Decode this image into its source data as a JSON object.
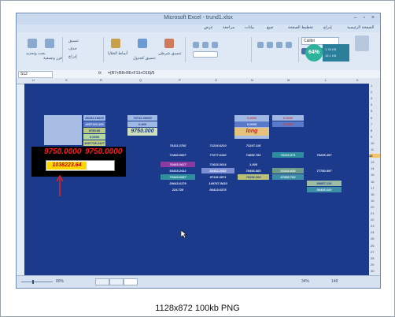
{
  "window": {
    "title": "Microsoft Excel - trund1.xlsx",
    "controls": "– ▫ ×"
  },
  "ribbon_tabs": [
    "الصفحة الرئيسية",
    "إدراج",
    "تخطيط الصفحة",
    "صيغ",
    "بيانات",
    "مراجعة",
    "عرض"
  ],
  "ribbon": {
    "font_name": "Calibri",
    "groups": [
      {
        "label": "إدراج"
      },
      {
        "label": "حذف"
      },
      {
        "label": "تنسيق"
      },
      {
        "label": "فرز وتصفية"
      },
      {
        "label": "بحث وتحديد"
      },
      {
        "label": "أنماط الخلايا"
      },
      {
        "label": "تنسيق شرطي"
      },
      {
        "label": "تنسيق كجدول"
      }
    ]
  },
  "overlay": {
    "percent": "64%",
    "up_rate": "1.76 KB",
    "down_rate": "15.1 KB"
  },
  "formula_bar": {
    "name_box": "S12",
    "fx": "fx",
    "formula": "=(R7+R8+R6+F13+O16)/5"
  },
  "column_headers": [
    "U",
    "S",
    "R",
    "Q",
    "P",
    "O",
    "N",
    "M",
    "L",
    "K"
  ],
  "row_headers": [
    "1",
    "2",
    "3",
    "4",
    "5",
    "6",
    "7",
    "8",
    "9",
    "10",
    "11",
    "12",
    "13",
    "14",
    "15",
    "16",
    "17",
    "18",
    "19",
    "20",
    "21",
    "22",
    "23",
    "24",
    "25",
    "26",
    "27",
    "28",
    "29",
    "30"
  ],
  "selected_row": "12",
  "cells": [
    {
      "id": "r6c1",
      "text": "86433.16629",
      "bg": "#9fb8e3",
      "fg": "#1e3c8c"
    },
    {
      "id": "r6c2",
      "text": "74712.30000",
      "bg": "#9fb8e3",
      "fg": "#1e3c8c"
    },
    {
      "id": "r6c3",
      "text": "0.0000",
      "bg": "#9fb8e3",
      "fg": "#d04040"
    },
    {
      "id": "r6c4",
      "text": "0.0000",
      "bg": "#9fb8e3",
      "fg": "#d04040"
    },
    {
      "id": "r7c1",
      "text": "4857194.365",
      "bg": "#5a79c9",
      "fg": "#d8e4ff"
    },
    {
      "id": "r7c2",
      "text": "0.900",
      "bg": "#9fb8e3",
      "fg": "#1e3c8c"
    },
    {
      "id": "r7c3",
      "text": "0.0000",
      "bg": "#5a79c9",
      "fg": "#e8eefc"
    },
    {
      "id": "r7c4",
      "text": "0.7586",
      "bg": "#5a79c9",
      "fg": "#d04040"
    },
    {
      "id": "r8c1",
      "text": "9750.00",
      "bg": "#b7c87e",
      "fg": "#1e3c8c"
    },
    {
      "id": "r8c2",
      "text": "9750.000",
      "bg": "#cfe0bc",
      "fg": "#1e3c8c"
    },
    {
      "id": "r8c3",
      "text": "long",
      "bg": "#e6c37c",
      "fg": "#c02020"
    },
    {
      "id": "r9c1",
      "text": "0.0000",
      "bg": "#b4d7a0",
      "fg": "#1e3c8c"
    },
    {
      "id": "r10c1",
      "text": "4057738.2427",
      "bg": "#c2d086",
      "fg": "#1e3c8c"
    },
    {
      "id": "r10c2",
      "text": "74113.3792",
      "bg": "#1b3a8c",
      "fg": "#e8eefc"
    },
    {
      "id": "r10c3",
      "text": "71216.6210",
      "bg": "#1b3a8c",
      "fg": "#e8eefc"
    },
    {
      "id": "r10c4",
      "text": "71247.118",
      "bg": "#1b3a8c",
      "fg": "#e8eefc"
    },
    {
      "id": "r11c1",
      "text": "72466.6607",
      "bg": "#1b3a8c",
      "fg": "#e8eefc"
    },
    {
      "id": "r11c2",
      "text": "77277.6152",
      "bg": "#1b3a8c",
      "fg": "#e8eefc"
    },
    {
      "id": "r11c3",
      "text": "74853.782",
      "bg": "#1b3a8c",
      "fg": "#e8eefc"
    },
    {
      "id": "r11c4",
      "text": "76219.371",
      "bg": "#2e8ea0",
      "fg": "#d8f4f8"
    },
    {
      "id": "r11c5",
      "text": "76205.497",
      "bg": "#1b3a8c",
      "fg": "#e8eefc"
    },
    {
      "id": "r12c1",
      "text": "76465.0627",
      "bg": "#8a3aa0",
      "fg": "#f0d8ff"
    },
    {
      "id": "r12c2",
      "text": "71633.3014",
      "bg": "#1b3a8c",
      "fg": "#e8eefc"
    },
    {
      "id": "r12c3",
      "text": "1.005",
      "bg": "#1b3a8c",
      "fg": "#e8eefc"
    },
    {
      "id": "r13c1",
      "text": "53415.2412",
      "bg": "#1b3a8c",
      "fg": "#e8eefc"
    },
    {
      "id": "r13c2",
      "text": "80452.2052",
      "bg": "#7d8fd3",
      "fg": "#eef2ff"
    },
    {
      "id": "r13c3",
      "text": "78493.583",
      "bg": "#1b3a8c",
      "fg": "#e8eefc"
    },
    {
      "id": "r13c4",
      "text": "81530.838",
      "bg": "#6d9b8a",
      "fg": "#e8f4ec"
    },
    {
      "id": "r13c5",
      "text": "77780.997",
      "bg": "#1b3a8c",
      "fg": "#e8eefc"
    },
    {
      "id": "r14c1",
      "text": "73349.6457",
      "bg": "#2f8f9c",
      "fg": "#e0f6fa"
    },
    {
      "id": "r14c2",
      "text": "57115.3871",
      "bg": "#1b3a8c",
      "fg": "#e8eefc"
    },
    {
      "id": "r14c3",
      "text": "78254.200",
      "bg": "#b9c176",
      "fg": "#1e3c8c"
    },
    {
      "id": "r14c4",
      "text": "67865.764",
      "bg": "#3e8ea8",
      "fg": "#e0f6fa"
    },
    {
      "id": "r15c1",
      "text": "20643.6179",
      "bg": "#1b3a8c",
      "fg": "#e8eefc"
    },
    {
      "id": "r15c2",
      "text": "149767.5633",
      "bg": "#1b3a8c",
      "fg": "#e8eefc"
    },
    {
      "id": "r15c3",
      "text": "85887.126",
      "bg": "#9cbca4",
      "fg": "#1e3c8c"
    },
    {
      "id": "r16c1",
      "text": "224.728",
      "bg": "#1b3a8c",
      "fg": "#e8eefc"
    },
    {
      "id": "r16c2",
      "text": "86413.6378",
      "bg": "#1b3a8c",
      "fg": "#e8eefc"
    },
    {
      "id": "r16c3",
      "text": "86405.020",
      "bg": "#3e8ea8",
      "fg": "#e0f6fa"
    }
  ],
  "annotation": {
    "value1": "9750.0000",
    "value2": "9750.0000",
    "result": "1038223.64"
  },
  "status_bar": {
    "zoom": "80%",
    "left_text": "34%",
    "count": "148"
  },
  "footer": "1128x872 100kb PNG"
}
